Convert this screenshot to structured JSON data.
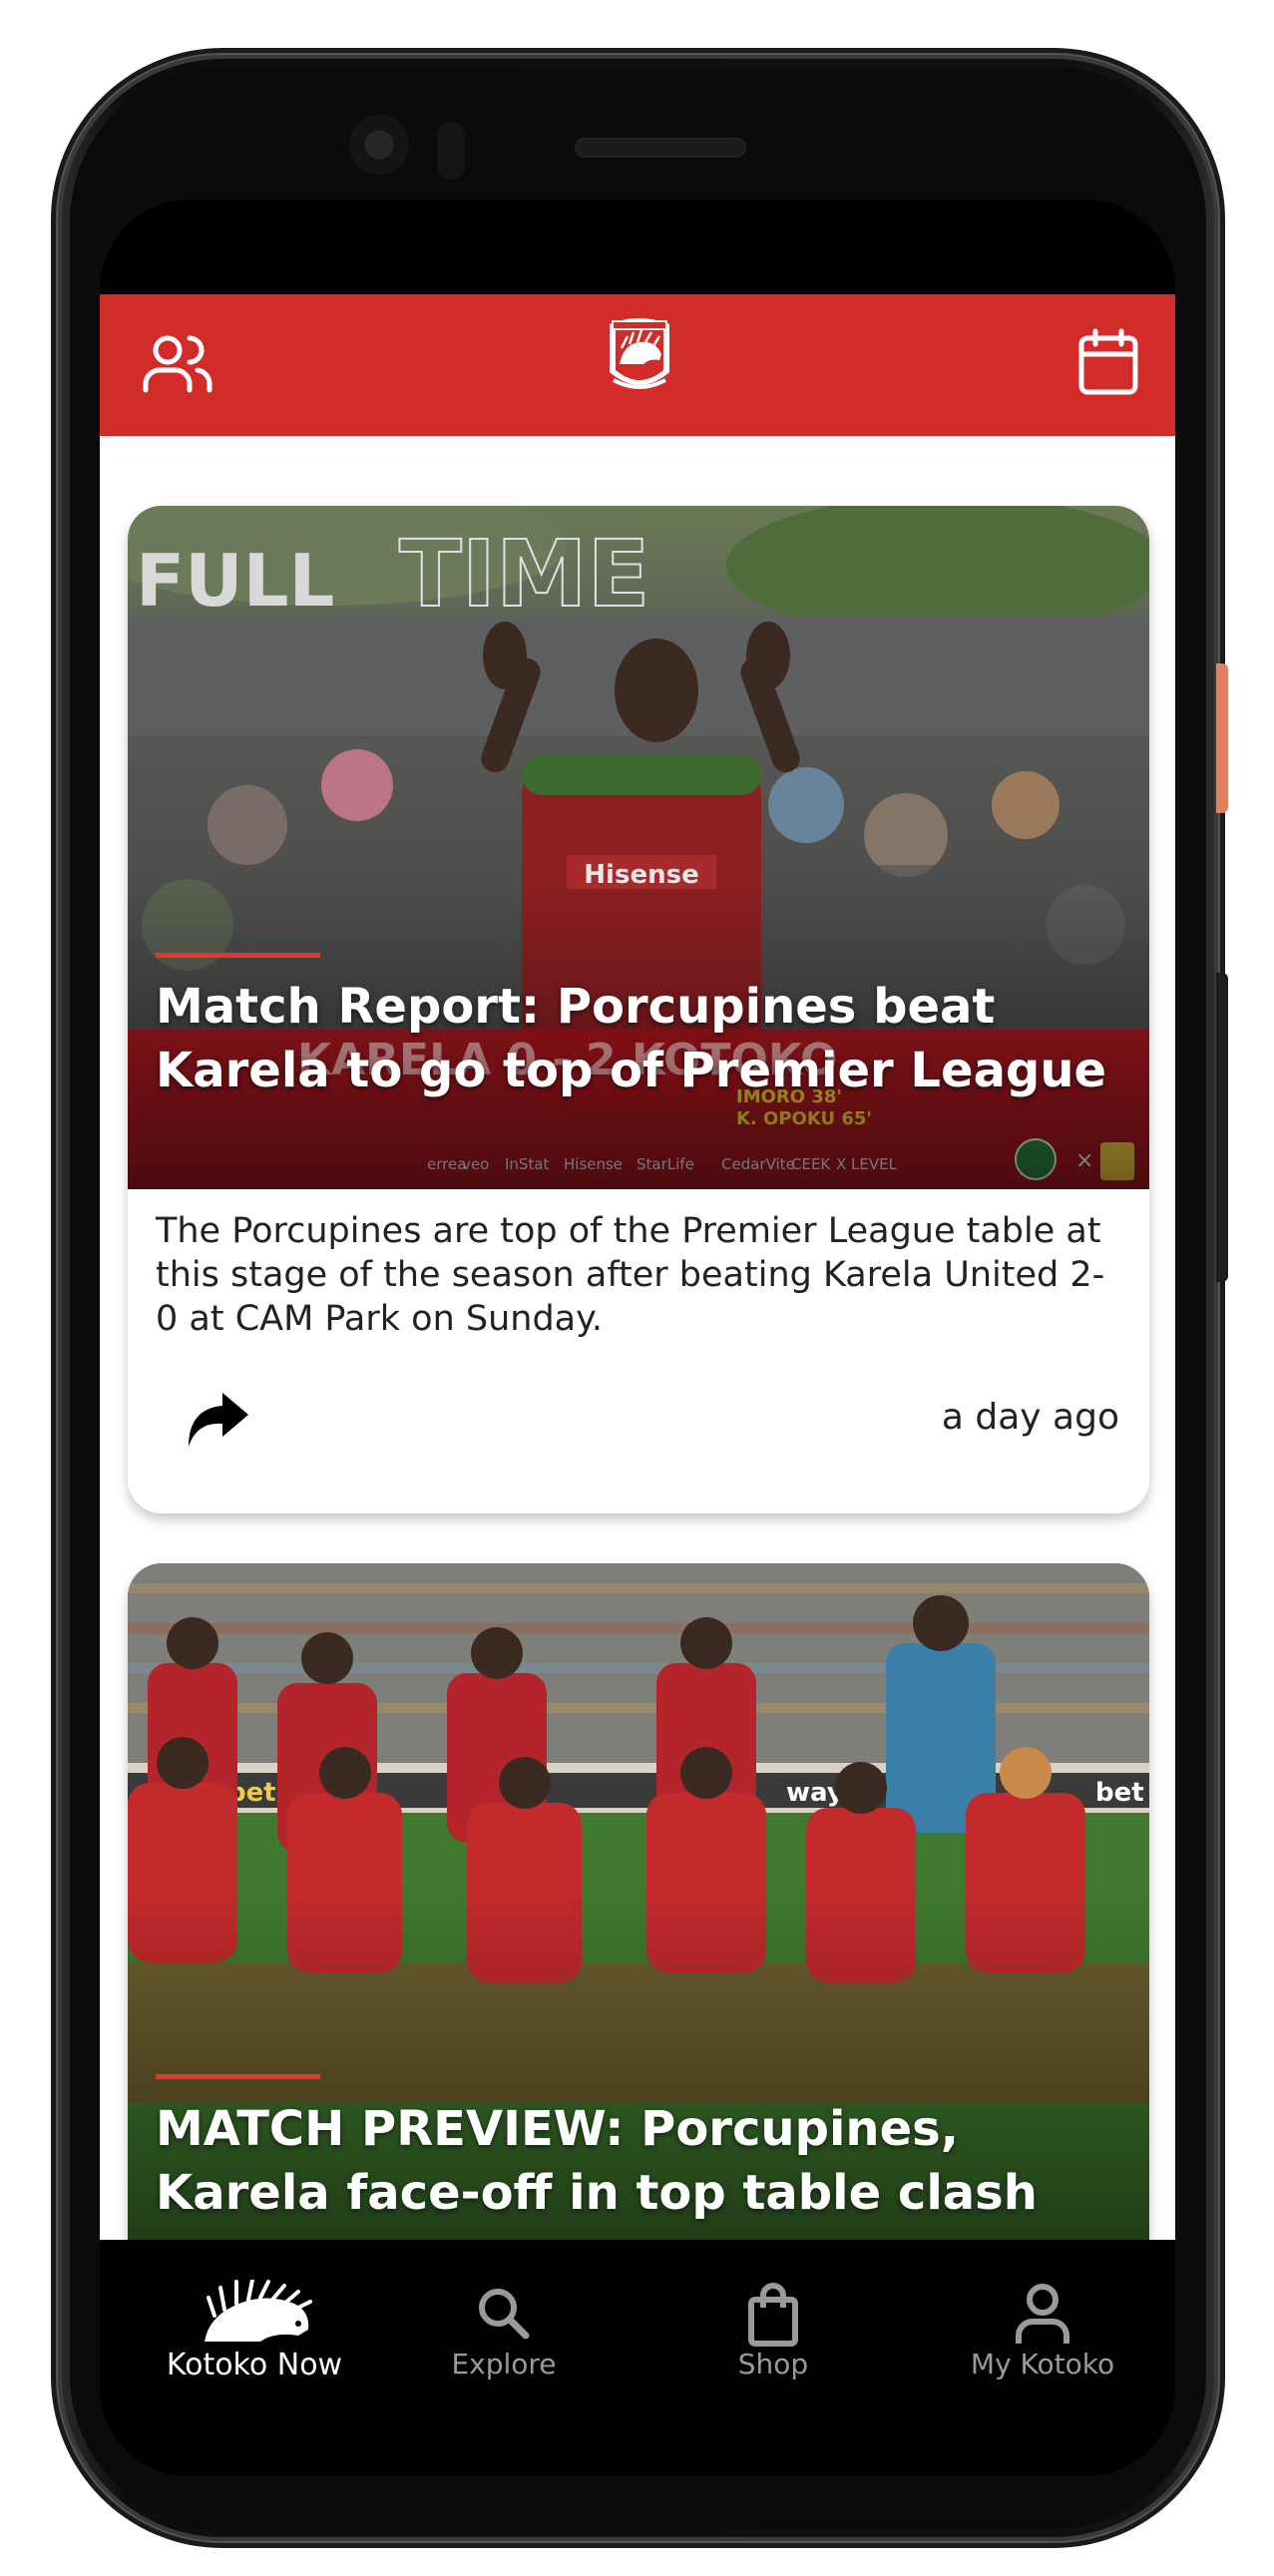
{
  "colors": {
    "brand_red": "#d22b29",
    "accent_red": "#e1392b",
    "nav_bg": "#000000",
    "nav_active": "#ffffff",
    "nav_inactive": "#9a9a9a"
  },
  "header": {
    "left_icon": "users-icon",
    "logo": "asante-kotoko-crest-logo",
    "right_icon": "calendar-icon"
  },
  "feed": [
    {
      "image_overlay": {
        "banner_word_1": "FULL",
        "banner_word_2": "TIME",
        "scoreline": "KARELA 0 - 2 KOTOKO",
        "scorers": [
          "IMORO 38'",
          "K. OPOKU 65'"
        ],
        "sponsors": [
          "errea",
          "veo",
          "InStat",
          "Hisense",
          "StarLife",
          "CedarVite",
          "CEEK",
          "X LEVEL"
        ]
      },
      "title": "Match Report: Porcupines beat Karela to go top of Premier League",
      "summary": "The Porcupines are top of the Premier League table at this stage of the season after beating Karela United 2-0 at CAM Park on Sunday.",
      "share_icon": "share-arrow-icon",
      "time": "a day ago"
    },
    {
      "title": "MATCH PREVIEW: Porcupines, Karela face-off in top table clash"
    }
  ],
  "bottom_nav": [
    {
      "label": "Kotoko Now",
      "icon": "porcupine-icon",
      "active": true
    },
    {
      "label": "Explore",
      "icon": "search-icon",
      "active": false
    },
    {
      "label": "Shop",
      "icon": "shopping-bag-icon",
      "active": false
    },
    {
      "label": "My Kotoko",
      "icon": "user-icon",
      "active": false
    }
  ]
}
